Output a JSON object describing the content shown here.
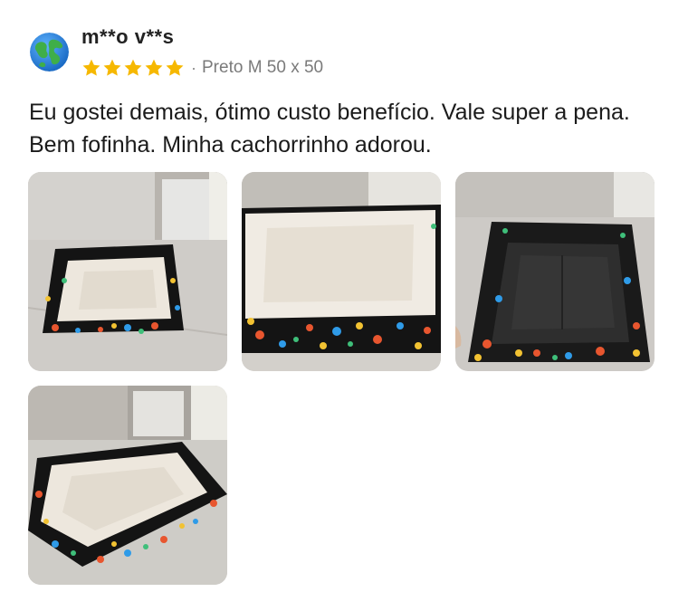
{
  "reviewer": {
    "name": "m**o v**s",
    "avatar_icon": "globe-icon"
  },
  "rating": {
    "stars": 5,
    "max": 5,
    "color": "#F6B800"
  },
  "separator": "·",
  "variant": "Preto M 50 x 50",
  "review_text": "Eu gostei demais, ótimo custo benefício. Vale super a pena. Bem fofinha. Minha cachorrinho adorou.",
  "photos_count": 4
}
